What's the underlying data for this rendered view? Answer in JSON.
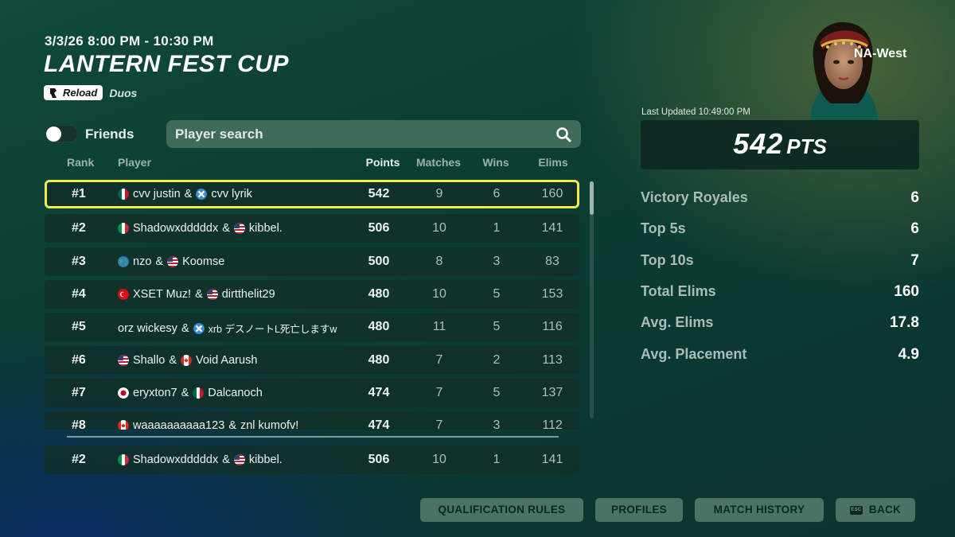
{
  "header": {
    "date": "3/3/26 8:00 PM - 10:30 PM",
    "title": "LANTERN FEST CUP",
    "badge": "Reload",
    "mode": "Duos"
  },
  "filters": {
    "friends_label": "Friends",
    "friends_on": false,
    "search_placeholder": "Player search"
  },
  "columns": {
    "rank": "Rank",
    "player": "Player",
    "points": "Points",
    "matches": "Matches",
    "wins": "Wins",
    "elims": "Elims"
  },
  "rows": [
    {
      "rank": "#1",
      "p1": "cvv justin",
      "f1": "mx",
      "amp": "&",
      "p2": "cvv lyrik",
      "f2": "x",
      "points": "542",
      "matches": "9",
      "wins": "6",
      "elims": "160",
      "highlight": true
    },
    {
      "rank": "#2",
      "p1": "Shadowxdddddx",
      "f1": "it",
      "amp": "&",
      "p2": "kibbel.",
      "f2": "us",
      "points": "506",
      "matches": "10",
      "wins": "1",
      "elims": "141"
    },
    {
      "rank": "#3",
      "p1": "nzo",
      "f1": "globe",
      "amp": "&",
      "p2": "Koomse",
      "f2": "us",
      "points": "500",
      "matches": "8",
      "wins": "3",
      "elims": "83"
    },
    {
      "rank": "#4",
      "p1": "XSET Muz!",
      "f1": "tr",
      "amp": "&",
      "p2": "dirtthelit29",
      "f2": "us",
      "points": "480",
      "matches": "10",
      "wins": "5",
      "elims": "153"
    },
    {
      "rank": "#5",
      "p1": "orz wickesy",
      "f1": "",
      "amp": "&",
      "p2": "xrb デスノートL死亡しますw",
      "f2": "x",
      "points": "480",
      "matches": "11",
      "wins": "5",
      "elims": "116"
    },
    {
      "rank": "#6",
      "p1": "Shallo",
      "f1": "us",
      "amp": "&",
      "p2": "Void Aarush",
      "f2": "ca",
      "points": "480",
      "matches": "7",
      "wins": "2",
      "elims": "113"
    },
    {
      "rank": "#7",
      "p1": "eryxton7",
      "f1": "jp",
      "amp": "&",
      "p2": "Dalcanoch",
      "f2": "mx",
      "points": "474",
      "matches": "7",
      "wins": "5",
      "elims": "137"
    },
    {
      "rank": "#8",
      "p1": "waaaaaaaaaa123",
      "f1": "ca",
      "amp": "&",
      "p2": "znl kumofv!",
      "f2": "",
      "points": "474",
      "matches": "7",
      "wins": "3",
      "elims": "112"
    }
  ],
  "my_row": {
    "rank": "#2",
    "p1": "Shadowxdddddx",
    "f1": "it",
    "amp": "&",
    "p2": "kibbel.",
    "f2": "us",
    "points": "506",
    "matches": "10",
    "wins": "1",
    "elims": "141"
  },
  "panel": {
    "region": "NA-West",
    "last_updated": "Last Updated 10:49:00 PM",
    "points_value": "542",
    "points_unit": "PTS",
    "stats": [
      {
        "label": "Victory Royales",
        "value": "6"
      },
      {
        "label": "Top 5s",
        "value": "6"
      },
      {
        "label": "Top 10s",
        "value": "7"
      },
      {
        "label": "Total Elims",
        "value": "160"
      },
      {
        "label": "Avg. Elims",
        "value": "17.8"
      },
      {
        "label": "Avg. Placement",
        "value": "4.9"
      }
    ]
  },
  "buttons": {
    "qualification_rules": "QUALIFICATION RULES",
    "profiles": "PROFILES",
    "match_history": "MATCH HISTORY",
    "esc_key": "ESC",
    "back": "BACK"
  },
  "colors": {
    "highlight": "#f3ec4a",
    "button_bg": "#4c7266",
    "background": "#0c3f34"
  }
}
